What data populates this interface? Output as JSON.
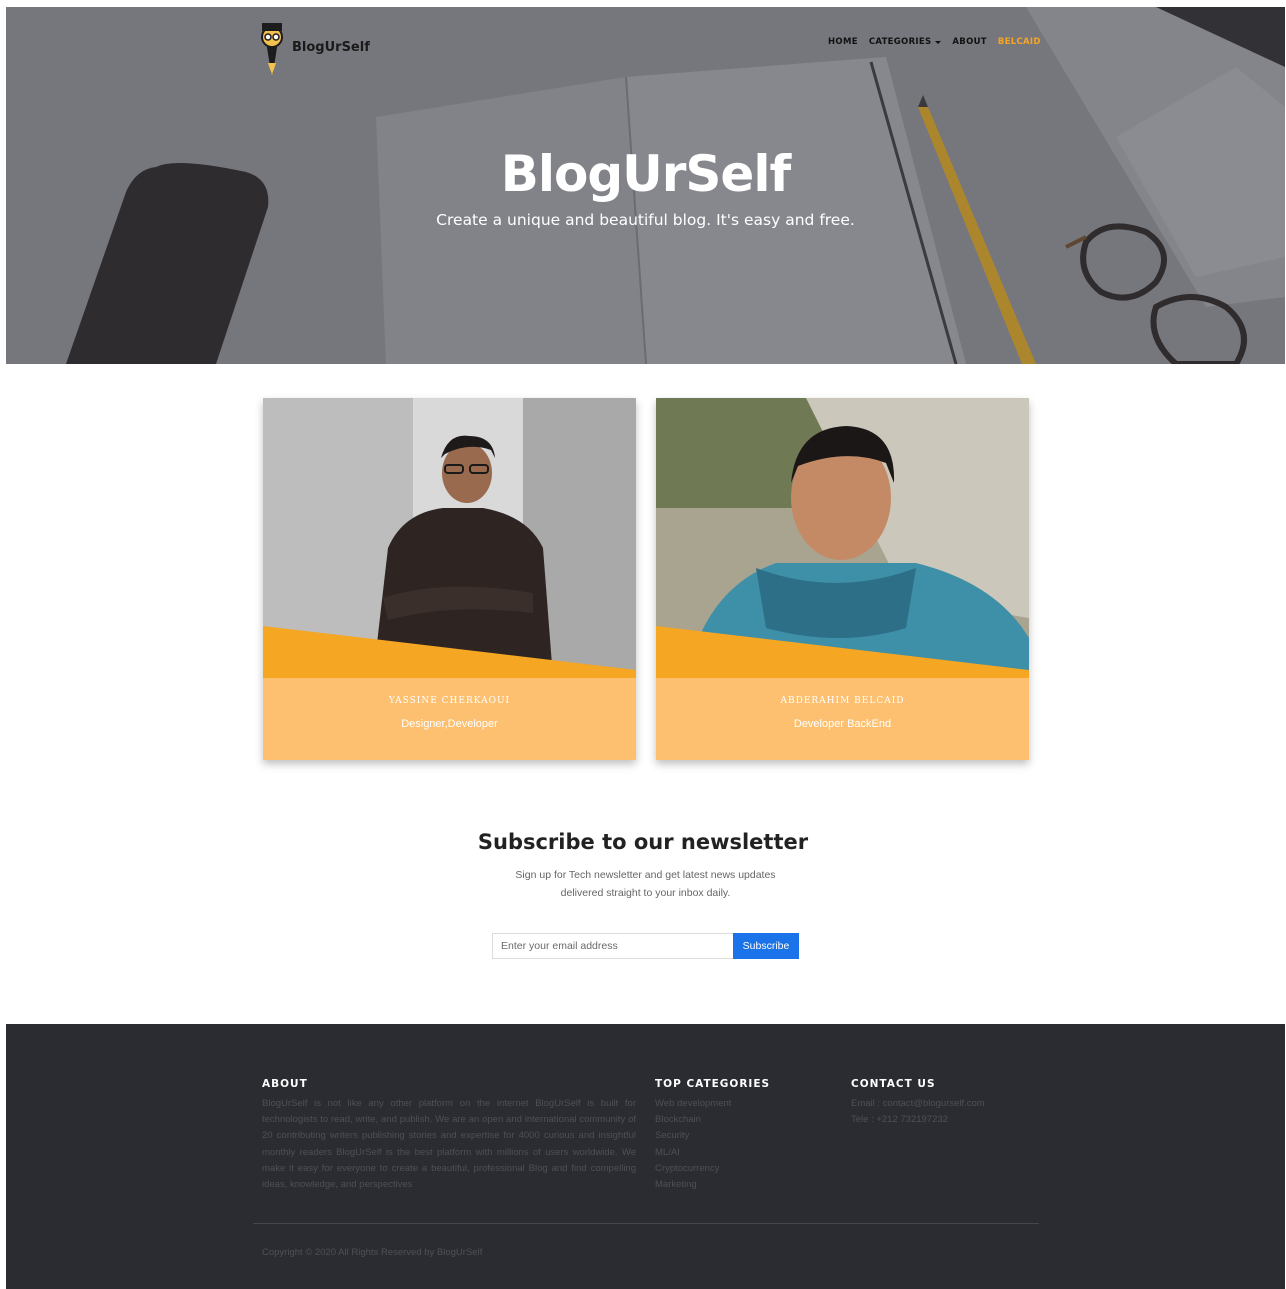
{
  "header": {
    "brand_name": "BlogUrSelf",
    "nav": {
      "home": "HOME",
      "categories": "CATEGORIES",
      "about": "ABOUT",
      "user": "BELCAID"
    }
  },
  "hero": {
    "title": "BlogUrSelf",
    "subtitle": "Create a unique and beautiful blog. It's easy and free."
  },
  "team": [
    {
      "name": "YASSINE CHERKAOUI",
      "role": "Designer,Developer"
    },
    {
      "name": "ABDERAHIM BELCAID",
      "role": "Developer BackEnd"
    }
  ],
  "newsletter": {
    "title": "Subscribe to our newsletter",
    "text": "Sign up for Tech newsletter and get latest news updates delivered straight to your inbox daily.",
    "placeholder": "Enter your email address",
    "button": "Subscribe"
  },
  "footer": {
    "about_heading": "ABOUT",
    "about_text": "BlogUrSelf is not like any other platform on the internet BlogUrSelf is built for technologists to read, write, and publish. We are an open and international community of 20 contributing writers publishing stories and expertise for 4000 curious and insightful monthly readers BlogUrSelf is the best platform with millions of users worldwide. We make it easy for everyone to create a beautiful, professional Blog and find compelling ideas, knowledge, and perspectives",
    "categories_heading": "TOP CATEGORIES",
    "categories": [
      "Web development",
      "Blockchain",
      "Security",
      "ML/AI",
      "Cryptocurrency",
      "Marketing"
    ],
    "contact_heading": "CONTACT US",
    "email": "Email : contact@blogurself.com",
    "phone": "Tele : +212 732197232",
    "copyright": "Copyright © 2020 All Rights Reserved by BlogUrSelf"
  },
  "colors": {
    "accent": "#f5a623",
    "card_bg": "#fdc070",
    "subscribe_button": "#1a73e8",
    "footer_bg": "#2b2c31"
  }
}
